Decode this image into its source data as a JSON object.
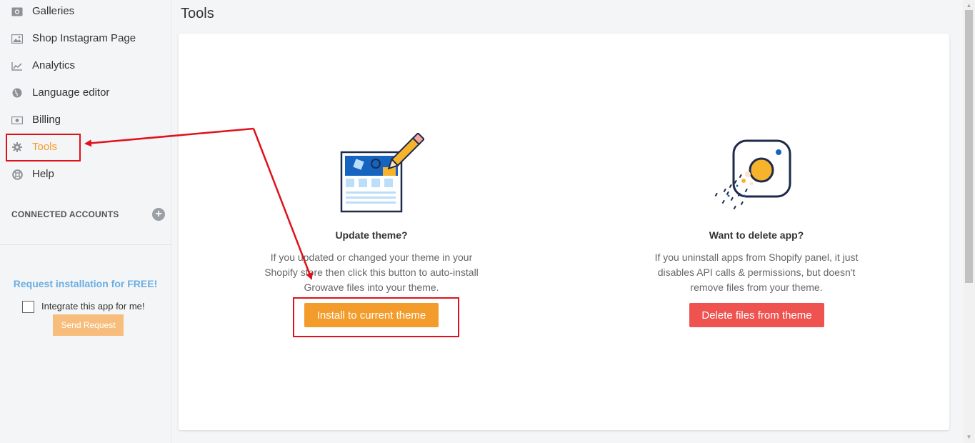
{
  "sidebar": {
    "items": [
      {
        "label": "Galleries",
        "icon": "camera-icon"
      },
      {
        "label": "Shop Instagram Page",
        "icon": "image-icon"
      },
      {
        "label": "Analytics",
        "icon": "chart-line-icon"
      },
      {
        "label": "Language editor",
        "icon": "globe-icon"
      },
      {
        "label": "Billing",
        "icon": "money-icon"
      },
      {
        "label": "Tools",
        "icon": "gear-icon",
        "active": true
      },
      {
        "label": "Help",
        "icon": "lifebuoy-icon"
      }
    ],
    "connected_accounts_label": "CONNECTED ACCOUNTS",
    "add_account_icon": "plus-circle-icon"
  },
  "request": {
    "title": "Request installation for FREE!",
    "checkbox_label": "Integrate this app for me!",
    "checked": false,
    "send_label": "Send Request"
  },
  "page": {
    "title": "Tools"
  },
  "update_theme": {
    "title": "Update theme?",
    "description": "If you updated or changed your theme in your Shopify store then click this button to auto-install Growave files into your theme.",
    "button_label": "Install to current theme",
    "icon": "theme-edit-icon"
  },
  "delete_app": {
    "title": "Want to delete app?",
    "description": "If you uninstall apps from Shopify panel, it just disables API calls & permissions, but doesn't remove files from your theme.",
    "button_label": "Delete files from theme",
    "icon": "instagram-dissolve-icon"
  },
  "colors": {
    "accent": "#f39c2b",
    "danger": "#ef5350",
    "link": "#6aaee3",
    "annotation": "#e0111b"
  }
}
